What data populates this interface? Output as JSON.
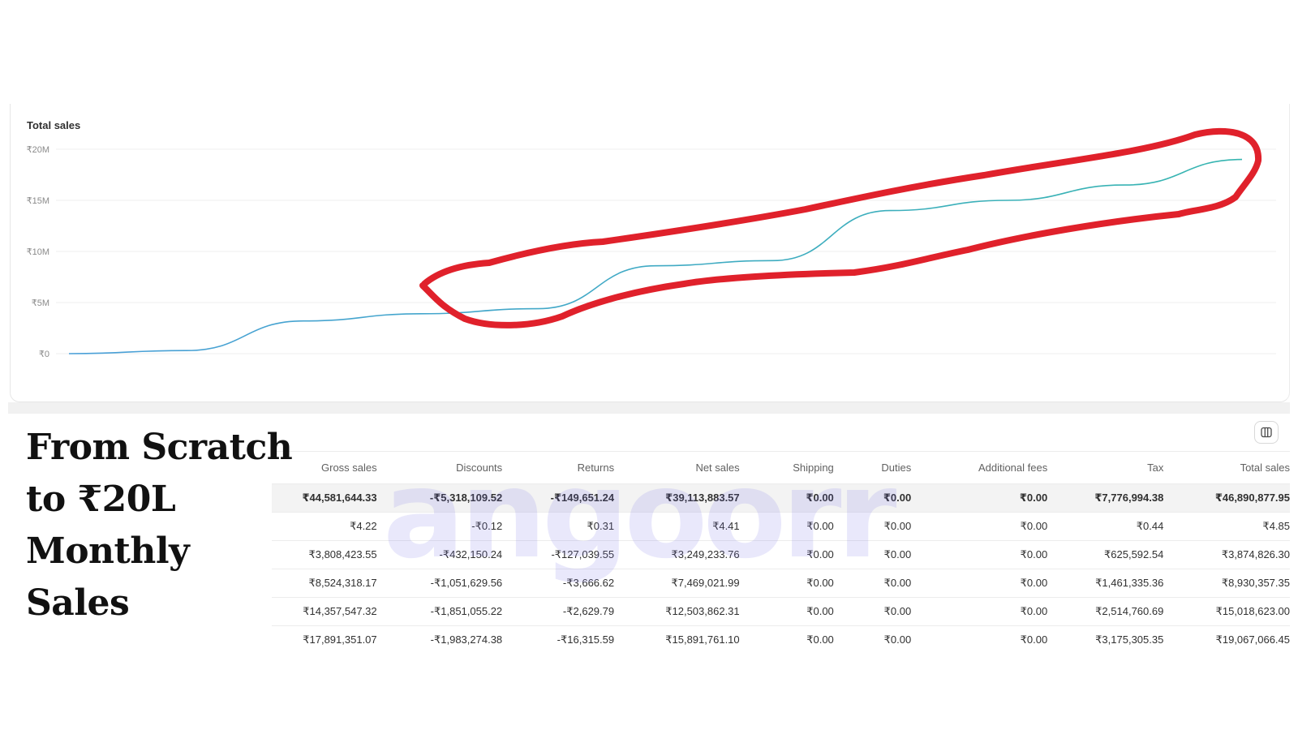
{
  "chart_data": {
    "type": "line",
    "title": "Total sales",
    "y_tick_labels": [
      "₹20M",
      "₹15M",
      "₹10M",
      "₹5M",
      "₹0"
    ],
    "y_tick_values": [
      20000000,
      15000000,
      10000000,
      5000000,
      0
    ],
    "ylim": [
      0,
      20000000
    ],
    "grid": true,
    "series": [
      {
        "values": [
          0,
          300000,
          3200000,
          3900000,
          4400000,
          8600000,
          9100000,
          14000000,
          15000000,
          16500000,
          19000000
        ],
        "line_color": "#36b5b0",
        "line_color_start": "#4a9fd8"
      }
    ],
    "annotation": {
      "shape": "hand-drawn loop",
      "color": "#e0212b"
    }
  },
  "table": {
    "columns": [
      "Gross sales",
      "Discounts",
      "Returns",
      "Net sales",
      "Shipping",
      "Duties",
      "Additional fees",
      "Tax",
      "Total sales"
    ],
    "summary": [
      "₹44,581,644.33",
      "-₹5,318,109.52",
      "-₹149,651.24",
      "₹39,113,883.57",
      "₹0.00",
      "₹0.00",
      "₹0.00",
      "₹7,776,994.38",
      "₹46,890,877.95"
    ],
    "rows": [
      [
        "₹4.22",
        "-₹0.12",
        "₹0.31",
        "₹4.41",
        "₹0.00",
        "₹0.00",
        "₹0.00",
        "₹0.44",
        "₹4.85"
      ],
      [
        "₹3,808,423.55",
        "-₹432,150.24",
        "-₹127,039.55",
        "₹3,249,233.76",
        "₹0.00",
        "₹0.00",
        "₹0.00",
        "₹625,592.54",
        "₹3,874,826.30"
      ],
      [
        "₹8,524,318.17",
        "-₹1,051,629.56",
        "-₹3,666.62",
        "₹7,469,021.99",
        "₹0.00",
        "₹0.00",
        "₹0.00",
        "₹1,461,335.36",
        "₹8,930,357.35"
      ],
      [
        "₹14,357,547.32",
        "-₹1,851,055.22",
        "-₹2,629.79",
        "₹12,503,862.31",
        "₹0.00",
        "₹0.00",
        "₹0.00",
        "₹2,514,760.69",
        "₹15,018,623.00"
      ],
      [
        "₹17,891,351.07",
        "-₹1,983,274.38",
        "-₹16,315.59",
        "₹15,891,761.10",
        "₹0.00",
        "₹0.00",
        "₹0.00",
        "₹3,175,305.35",
        "₹19,067,066.45"
      ]
    ],
    "column_toggle_icon": "columns-icon"
  },
  "overlay": {
    "headline": [
      "From Scratch",
      "to ₹20L",
      "Monthly",
      "Sales"
    ],
    "watermark": "angoorr"
  }
}
